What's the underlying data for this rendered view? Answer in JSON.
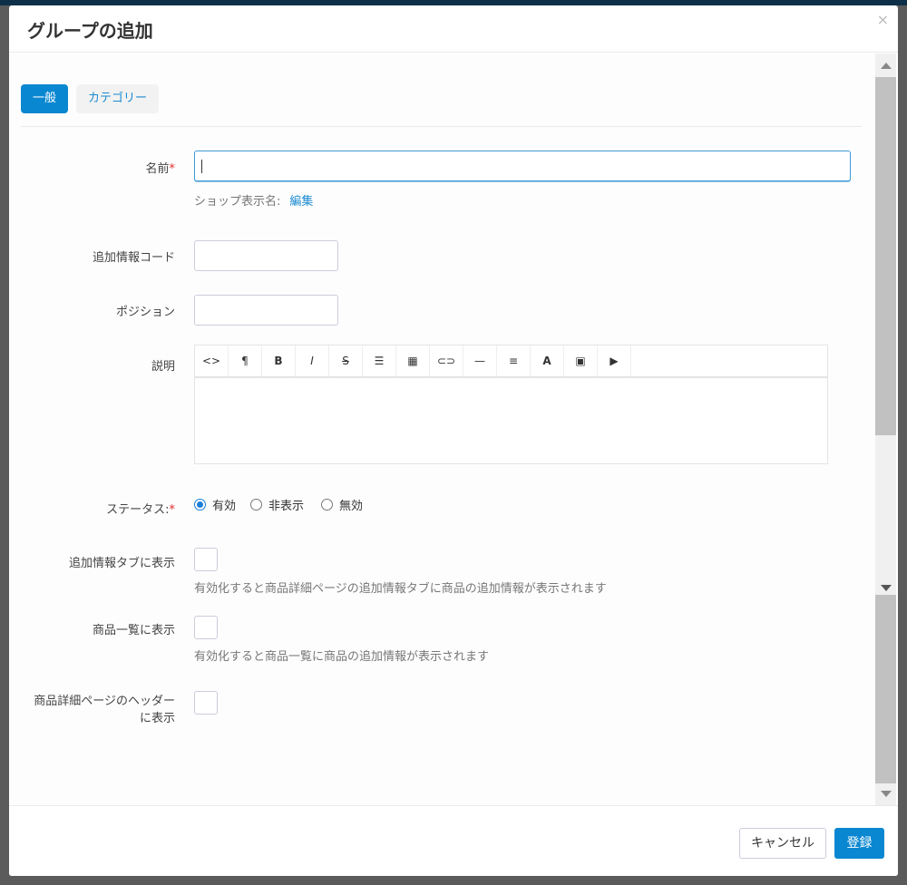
{
  "modal": {
    "title": "グループの追加",
    "close": "×"
  },
  "tabs": [
    {
      "label": "一般"
    },
    {
      "label": "カテゴリー"
    }
  ],
  "form": {
    "name_label": "名前",
    "required_mark": "*",
    "name_value": "",
    "shop_name_label": "ショップ表示名:",
    "shop_name_link": "編集",
    "code_label": "追加情報コード",
    "code_value": "",
    "position_label": "ポジション",
    "position_value": "",
    "description_label": "説明",
    "status_label": "ステータス:",
    "status_options": [
      "有効",
      "非表示",
      "無効"
    ],
    "status_selected": "有効",
    "tab_show_label": "追加情報タブに表示",
    "tab_show_hint": "有効化すると商品詳細ページの追加情報タブに商品の追加情報が表示されます",
    "list_show_label": "商品一覧に表示",
    "list_show_hint": "有効化すると商品一覧に商品の追加情報が表示されます",
    "header_show_label_1": "商品詳細ページのヘッダー",
    "header_show_label_2": "に表示"
  },
  "toolbar": [
    {
      "icon": "code-icon",
      "glyph": "<>"
    },
    {
      "icon": "paragraph-icon",
      "glyph": "¶"
    },
    {
      "icon": "bold-icon",
      "glyph": "B"
    },
    {
      "icon": "italic-icon",
      "glyph": "I"
    },
    {
      "icon": "strikethrough-icon",
      "glyph": "S̶"
    },
    {
      "icon": "list-icon",
      "glyph": "☰"
    },
    {
      "icon": "table-icon",
      "glyph": "▦"
    },
    {
      "icon": "link-icon",
      "glyph": "⊂⊃"
    },
    {
      "icon": "horizontal-rule-icon",
      "glyph": "—"
    },
    {
      "icon": "align-icon",
      "glyph": "≡"
    },
    {
      "icon": "text-color-icon",
      "glyph": "A"
    },
    {
      "icon": "image-icon",
      "glyph": "▣"
    },
    {
      "icon": "video-icon",
      "glyph": "▶"
    }
  ],
  "footer": {
    "cancel": "キャンセル",
    "submit": "登録"
  },
  "colors": {
    "accent": "#0a87d1",
    "required": "#e02b2b"
  }
}
